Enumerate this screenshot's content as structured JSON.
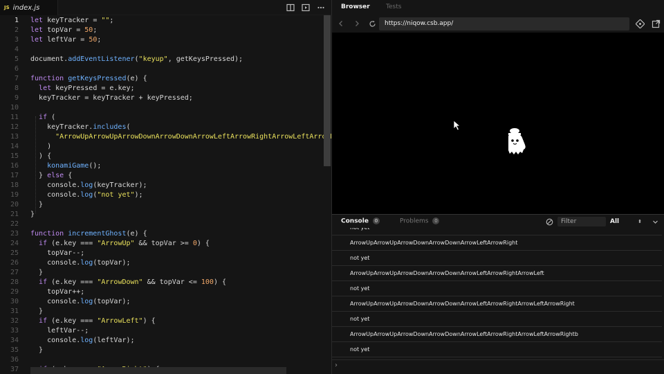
{
  "editor": {
    "tab_badge": "JS",
    "tab_label": "index.js",
    "active_line": 1,
    "lines": [
      {
        "n": "1",
        "t": [
          [
            "kw",
            "let "
          ],
          [
            "id",
            "keyTracker = "
          ],
          [
            "str",
            "\"\""
          ],
          [
            "id",
            ";"
          ]
        ]
      },
      {
        "n": "2",
        "t": [
          [
            "kw",
            "let "
          ],
          [
            "id",
            "topVar = "
          ],
          [
            "num",
            "50"
          ],
          [
            "id",
            ";"
          ]
        ]
      },
      {
        "n": "3",
        "t": [
          [
            "kw",
            "let "
          ],
          [
            "id",
            "leftVar = "
          ],
          [
            "num",
            "50"
          ],
          [
            "id",
            ";"
          ]
        ]
      },
      {
        "n": "4",
        "t": []
      },
      {
        "n": "5",
        "t": [
          [
            "id",
            "document."
          ],
          [
            "fn",
            "addEventListener"
          ],
          [
            "id",
            "("
          ],
          [
            "str",
            "\"keyup\""
          ],
          [
            "id",
            ", getKeysPressed);"
          ]
        ]
      },
      {
        "n": "6",
        "t": []
      },
      {
        "n": "7",
        "t": [
          [
            "kw",
            "function "
          ],
          [
            "fn",
            "getKeysPressed"
          ],
          [
            "id",
            "(e) {"
          ]
        ]
      },
      {
        "n": "8",
        "t": [
          [
            "id",
            "  "
          ],
          [
            "kw",
            "let "
          ],
          [
            "id",
            "keyPressed = e.key;"
          ]
        ]
      },
      {
        "n": "9",
        "t": [
          [
            "id",
            "  keyTracker = keyTracker + keyPressed;"
          ]
        ]
      },
      {
        "n": "10",
        "t": []
      },
      {
        "n": "11",
        "t": [
          [
            "id",
            "  "
          ],
          [
            "kw",
            "if"
          ],
          [
            "id",
            " ("
          ]
        ]
      },
      {
        "n": "12",
        "t": [
          [
            "id",
            "    keyTracker."
          ],
          [
            "fn",
            "includes"
          ],
          [
            "id",
            "("
          ]
        ]
      },
      {
        "n": "13",
        "t": [
          [
            "id",
            "      "
          ],
          [
            "str",
            "\"ArrowUpArrowUpArrowDownArrowDownArrowLeftArrowRightArrowLeftArrowRight\""
          ]
        ]
      },
      {
        "n": "14",
        "t": [
          [
            "id",
            "    )"
          ]
        ]
      },
      {
        "n": "15",
        "t": [
          [
            "id",
            "  ) {"
          ]
        ]
      },
      {
        "n": "16",
        "t": [
          [
            "id",
            "    "
          ],
          [
            "fn",
            "konamiGame"
          ],
          [
            "id",
            "();"
          ]
        ]
      },
      {
        "n": "17",
        "t": [
          [
            "id",
            "  } "
          ],
          [
            "kw",
            "else"
          ],
          [
            "id",
            " {"
          ]
        ]
      },
      {
        "n": "18",
        "t": [
          [
            "id",
            "    console."
          ],
          [
            "fn",
            "log"
          ],
          [
            "id",
            "(keyTracker);"
          ]
        ]
      },
      {
        "n": "19",
        "t": [
          [
            "id",
            "    console."
          ],
          [
            "fn",
            "log"
          ],
          [
            "id",
            "("
          ],
          [
            "str",
            "\"not yet\""
          ],
          [
            "id",
            ");"
          ]
        ]
      },
      {
        "n": "20",
        "t": [
          [
            "id",
            "  }"
          ]
        ]
      },
      {
        "n": "21",
        "t": [
          [
            "id",
            "}"
          ]
        ]
      },
      {
        "n": "22",
        "t": []
      },
      {
        "n": "23",
        "t": [
          [
            "kw",
            "function "
          ],
          [
            "fn",
            "incrementGhost"
          ],
          [
            "id",
            "(e) {"
          ]
        ]
      },
      {
        "n": "24",
        "t": [
          [
            "id",
            "  "
          ],
          [
            "kw",
            "if"
          ],
          [
            "id",
            " (e.key === "
          ],
          [
            "str",
            "\"ArrowUp\""
          ],
          [
            "id",
            " && topVar >= "
          ],
          [
            "num",
            "0"
          ],
          [
            "id",
            ") {"
          ]
        ]
      },
      {
        "n": "25",
        "t": [
          [
            "id",
            "    topVar--;"
          ]
        ]
      },
      {
        "n": "26",
        "t": [
          [
            "id",
            "    console."
          ],
          [
            "fn",
            "log"
          ],
          [
            "id",
            "(topVar);"
          ]
        ]
      },
      {
        "n": "27",
        "t": [
          [
            "id",
            "  }"
          ]
        ]
      },
      {
        "n": "28",
        "t": [
          [
            "id",
            "  "
          ],
          [
            "kw",
            "if"
          ],
          [
            "id",
            " (e.key === "
          ],
          [
            "str",
            "\"ArrowDown\""
          ],
          [
            "id",
            " && topVar <= "
          ],
          [
            "num",
            "100"
          ],
          [
            "id",
            ") {"
          ]
        ]
      },
      {
        "n": "29",
        "t": [
          [
            "id",
            "    topVar++;"
          ]
        ]
      },
      {
        "n": "30",
        "t": [
          [
            "id",
            "    console."
          ],
          [
            "fn",
            "log"
          ],
          [
            "id",
            "(topVar);"
          ]
        ]
      },
      {
        "n": "31",
        "t": [
          [
            "id",
            "  }"
          ]
        ]
      },
      {
        "n": "32",
        "t": [
          [
            "id",
            "  "
          ],
          [
            "kw",
            "if"
          ],
          [
            "id",
            " (e.key === "
          ],
          [
            "str",
            "\"ArrowLeft\""
          ],
          [
            "id",
            ") {"
          ]
        ]
      },
      {
        "n": "33",
        "t": [
          [
            "id",
            "    leftVar--;"
          ]
        ]
      },
      {
        "n": "34",
        "t": [
          [
            "id",
            "    console."
          ],
          [
            "fn",
            "log"
          ],
          [
            "id",
            "(leftVar);"
          ]
        ]
      },
      {
        "n": "35",
        "t": [
          [
            "id",
            "  }"
          ]
        ]
      },
      {
        "n": "36",
        "t": []
      },
      {
        "n": "37",
        "t": [
          [
            "id",
            "  "
          ],
          [
            "kw",
            "if"
          ],
          [
            "id",
            " (e.key === "
          ],
          [
            "str",
            "\"ArrowRight\""
          ],
          [
            "id",
            ") {"
          ]
        ]
      }
    ]
  },
  "browser": {
    "tab_browser": "Browser",
    "tab_tests": "Tests",
    "url": "https://niqow.csb.app/"
  },
  "console": {
    "tab_console": "Console",
    "console_count": "0",
    "tab_problems": "Problems",
    "problems_count": "0",
    "filter_placeholder": "Filter",
    "level": "All",
    "partial_top": "not yet",
    "entries": [
      "ArrowUpArrowUpArrowDownArrowDownArrowLeftArrowRight",
      "not yet",
      "ArrowUpArrowUpArrowDownArrowDownArrowLeftArrowRightArrowLeft",
      "not yet",
      "ArrowUpArrowUpArrowDownArrowDownArrowLeftArrowRightArrowLeftArrowRight",
      "not yet",
      "ArrowUpArrowUpArrowDownArrowDownArrowLeftArrowRightArrowLeftArrowRightb",
      "not yet"
    ],
    "prompt": "›"
  }
}
